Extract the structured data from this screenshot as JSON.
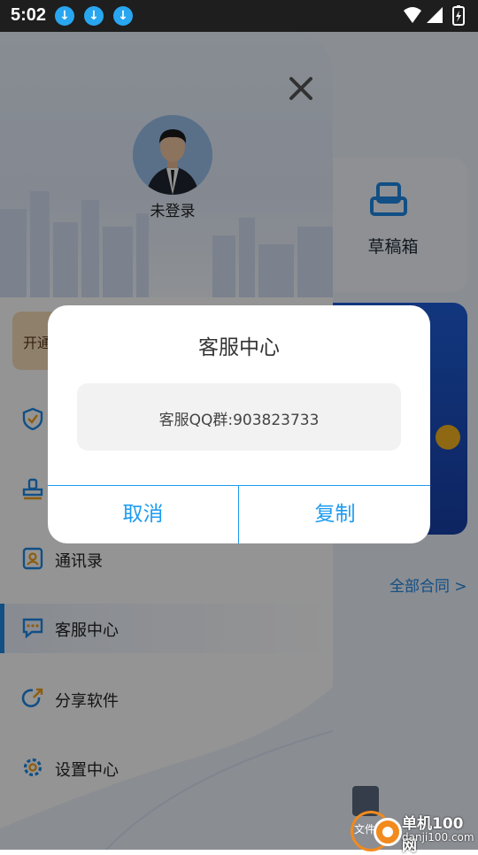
{
  "status_bar": {
    "time": "5:02",
    "download_icons": [
      "download-icon",
      "download-icon",
      "download-icon"
    ],
    "right_icons": [
      "wifi-icon",
      "signal-icon",
      "battery-icon"
    ]
  },
  "background": {
    "draft_label": "草稿箱",
    "all_contracts": "全部合同 >"
  },
  "drawer": {
    "login_status": "未登录",
    "vip_text": "开通",
    "menu": [
      {
        "label": "",
        "icon": "shield-icon"
      },
      {
        "label": "",
        "icon": "seal-icon"
      },
      {
        "label": "通讯录",
        "icon": "contacts-icon"
      },
      {
        "label": "客服中心",
        "icon": "chat-icon"
      },
      {
        "label": "分享软件",
        "icon": "share-icon"
      },
      {
        "label": "设置中心",
        "icon": "settings-icon"
      }
    ]
  },
  "dialog": {
    "title": "客服中心",
    "message": "客服QQ群:903823733",
    "cancel_label": "取消",
    "copy_label": "复制"
  },
  "watermark": {
    "title": "单机100网",
    "url": "danji100.com",
    "partial_text": "文件"
  },
  "colors": {
    "accent": "#1e9bf0",
    "status_bar": "#1e1e1e",
    "vip": "#f6dcb9"
  }
}
